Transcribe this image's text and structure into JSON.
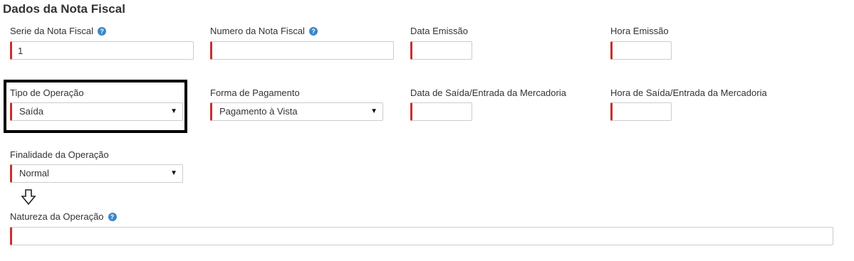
{
  "section": {
    "title": "Dados da Nota Fiscal"
  },
  "fields": {
    "serie": {
      "label": "Serie da Nota Fiscal",
      "value": "1"
    },
    "numero": {
      "label": "Numero da Nota Fiscal",
      "value": ""
    },
    "data_emissao": {
      "label": "Data Emissão",
      "value": ""
    },
    "hora_emissao": {
      "label": "Hora Emissão",
      "value": ""
    },
    "tipo_operacao": {
      "label": "Tipo de Operação",
      "value": "Saída"
    },
    "forma_pagamento": {
      "label": "Forma de Pagamento",
      "value": "Pagamento à Vista"
    },
    "data_saida": {
      "label": "Data de Saída/Entrada da Mercadoria",
      "value": ""
    },
    "hora_saida": {
      "label": "Hora de Saída/Entrada da Mercadoria",
      "value": ""
    },
    "finalidade": {
      "label": "Finalidade da Operação",
      "value": "Normal"
    },
    "natureza": {
      "label": "Natureza da Operação",
      "value": ""
    }
  },
  "icons": {
    "help": "question-circle-icon",
    "caret": "caret-down-icon",
    "arrow": "arrow-down-outline-icon"
  },
  "colors": {
    "required_border": "#c9302c",
    "help_icon": "#3a87c8",
    "highlight": "#000000"
  }
}
